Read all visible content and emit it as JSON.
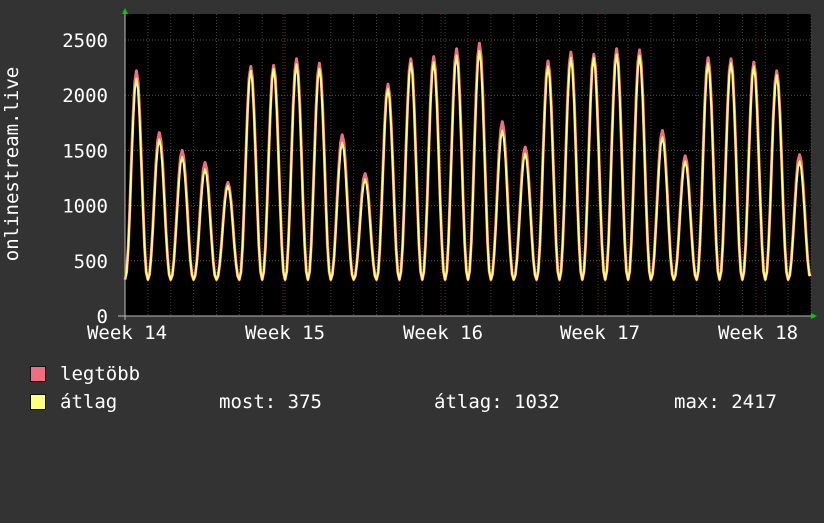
{
  "chart_data": {
    "type": "line",
    "ylabel": "onlinestream.live",
    "ylim": [
      0,
      2600
    ],
    "yticks": [
      0,
      500,
      1000,
      1500,
      2000,
      2500
    ],
    "x_tick_labels": [
      "Week 14",
      "Week 15",
      "Week 16",
      "Week 17",
      "Week 18"
    ],
    "grid": true,
    "series": [
      {
        "name": "legtöbb",
        "color": "#f26d7d",
        "daily_peaks": [
          2220,
          1660,
          1500,
          1390,
          1210,
          2260,
          2270,
          2330,
          2290,
          1640,
          1290,
          2100,
          2330,
          2350,
          2420,
          2470,
          1760,
          1530,
          2310,
          2390,
          2370,
          2420,
          2410,
          1680,
          1450,
          2340,
          2330,
          2300,
          2220,
          1460
        ]
      },
      {
        "name": "átlag",
        "color": "#ffff80",
        "daily_peaks": [
          2150,
          1600,
          1440,
          1330,
          1180,
          2220,
          2240,
          2280,
          2240,
          1570,
          1240,
          2060,
          2290,
          2300,
          2360,
          2400,
          1680,
          1470,
          2260,
          2340,
          2340,
          2370,
          2360,
          1620,
          1400,
          2290,
          2290,
          2260,
          2180,
          1400
        ]
      }
    ],
    "baseline": 330
  },
  "legend": {
    "max_label": "legtöbb",
    "avg_label": "átlag",
    "current": "most: 375",
    "average": "átlag: 1032",
    "maximum": "max: 2417"
  },
  "colors": {
    "background": "#333333",
    "plot_bg": "#000000",
    "grid": "#4a4a4a",
    "axis_arrow": "#00cc00"
  }
}
